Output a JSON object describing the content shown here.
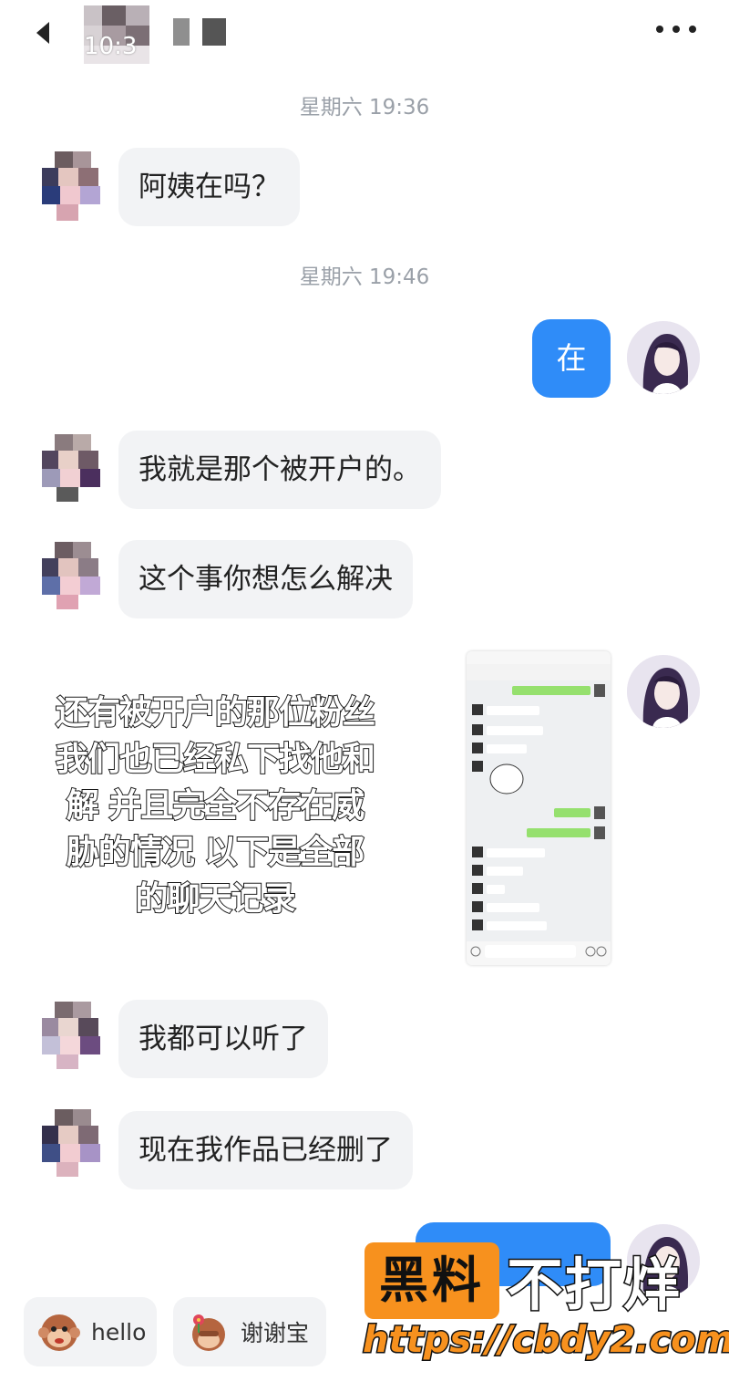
{
  "header": {
    "back_icon": "chevron-left-icon",
    "status_time": "10:3",
    "more_icon": "more-horizontal-icon"
  },
  "messages": [
    {
      "type": "time",
      "text": "星期六 19:36"
    },
    {
      "type": "incoming",
      "text": "阿姨在吗？"
    },
    {
      "type": "time",
      "text": "星期六 19:46"
    },
    {
      "type": "outgoing",
      "text": "在"
    },
    {
      "type": "incoming",
      "text": "我就是那个被开户的。"
    },
    {
      "type": "incoming",
      "text": "这个事你想怎么解决"
    },
    {
      "type": "incoming",
      "text": "我都可以听了"
    },
    {
      "type": "incoming",
      "text": "现在我作品已经删了"
    }
  ],
  "overlay_caption": {
    "lines": [
      "还有被开户的那位粉丝",
      "我们也已经私下找他和",
      "解 并且完全不存在威",
      "胁的情况 以下是全部",
      "的聊天记录"
    ]
  },
  "quick_replies": [
    {
      "emoji": "monkey-emoji",
      "label": "hello"
    },
    {
      "emoji": "monkey-flower-emoji",
      "label": "谢谢宝"
    }
  ],
  "watermark": {
    "box_text": "黑料",
    "side_text": "不打烊",
    "url": "https://cbdy2.com"
  },
  "colors": {
    "outgoing_bubble": "#2f8cf8",
    "incoming_bubble": "#f2f3f5",
    "timestamp": "#9aa0a8",
    "watermark_orange": "#f7911e"
  }
}
